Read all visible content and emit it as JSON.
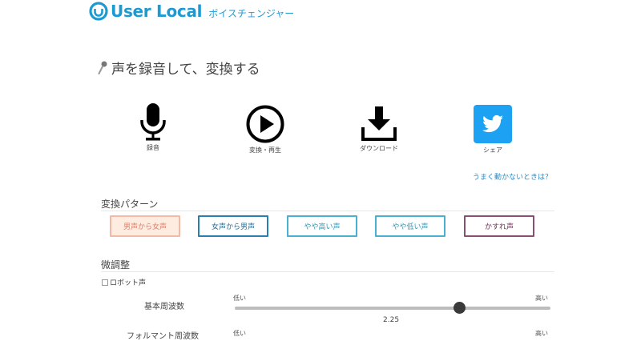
{
  "header": {
    "brand": "User Local",
    "product": "ボイスチェンジャー",
    "brand_color": "#1e9ad3"
  },
  "record_section": {
    "title": "声を録音して、変換する",
    "title_icon": "microphone-icon"
  },
  "actions": [
    {
      "label": "録音",
      "icon": "microphone-icon"
    },
    {
      "label": "変換・再生",
      "icon": "play-circle-icon"
    },
    {
      "label": "ダウンロード",
      "icon": "download-icon"
    },
    {
      "label": "シェア",
      "icon": "twitter-icon"
    }
  ],
  "help_link": "うまく動かないときは？",
  "patterns": {
    "heading": "変換パターン",
    "buttons": [
      {
        "label": "男声から女声",
        "selected": true
      },
      {
        "label": "女声から男声",
        "selected": false
      },
      {
        "label": "やや高い声",
        "selected": false
      },
      {
        "label": "やや低い声",
        "selected": false
      },
      {
        "label": "かすれ声",
        "selected": false
      }
    ]
  },
  "fine_tune": {
    "heading": "微調整",
    "robot_voice_label": "ロボット声",
    "robot_voice_checked": false,
    "params": [
      {
        "label": "基本周波数",
        "low": "低い",
        "high": "高い",
        "value": "2.25",
        "fraction": 0.71
      },
      {
        "label": "フォルマント周波数",
        "low": "低い",
        "high": "高い"
      }
    ]
  }
}
